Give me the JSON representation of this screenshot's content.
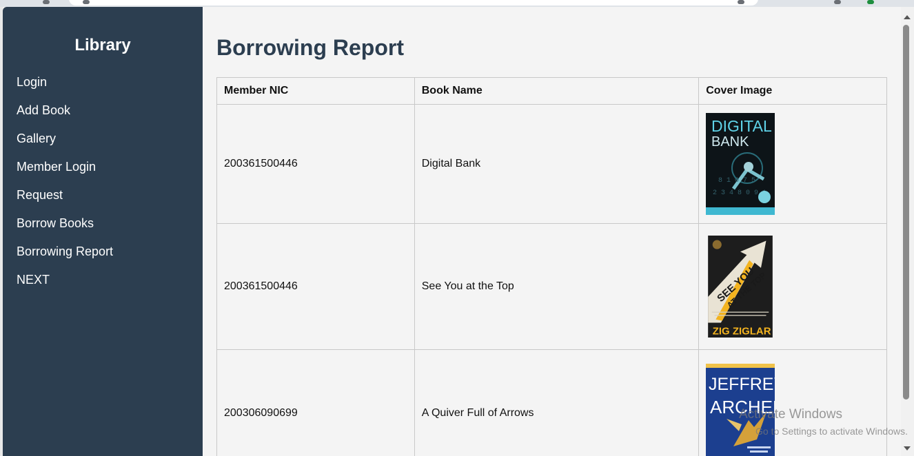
{
  "sidebar": {
    "brand": "Library",
    "items": [
      {
        "label": "Login"
      },
      {
        "label": "Add Book"
      },
      {
        "label": "Gallery"
      },
      {
        "label": "Member Login"
      },
      {
        "label": "Request"
      },
      {
        "label": "Borrow Books"
      },
      {
        "label": "Borrowing Report"
      },
      {
        "label": "NEXT"
      }
    ]
  },
  "main": {
    "title": "Borrowing Report",
    "table": {
      "headers": [
        "Member NIC",
        "Book Name",
        "Cover Image"
      ],
      "rows": [
        {
          "nic": "200361500446",
          "book": "Digital Bank",
          "cover_top": "DIGITAL",
          "cover_bottom": "BANK"
        },
        {
          "nic": "200361500446",
          "book": "See You at the Top",
          "cover_top": "SEE YOU",
          "cover_bottom": "AT THE TOP",
          "cover_author": "ZIG ZIGLAR"
        },
        {
          "nic": "200306090699",
          "book": "A Quiver Full of Arrows",
          "cover_top": "JEFFREY",
          "cover_bottom": "ARCHER"
        }
      ]
    }
  },
  "watermark": {
    "line1": "Activate Windows",
    "line2": "Go to Settings to activate Windows."
  },
  "colors": {
    "sidebar_bg": "#2c3e50",
    "title_color": "#2c3e50",
    "page_bg": "#f4f4f4"
  }
}
